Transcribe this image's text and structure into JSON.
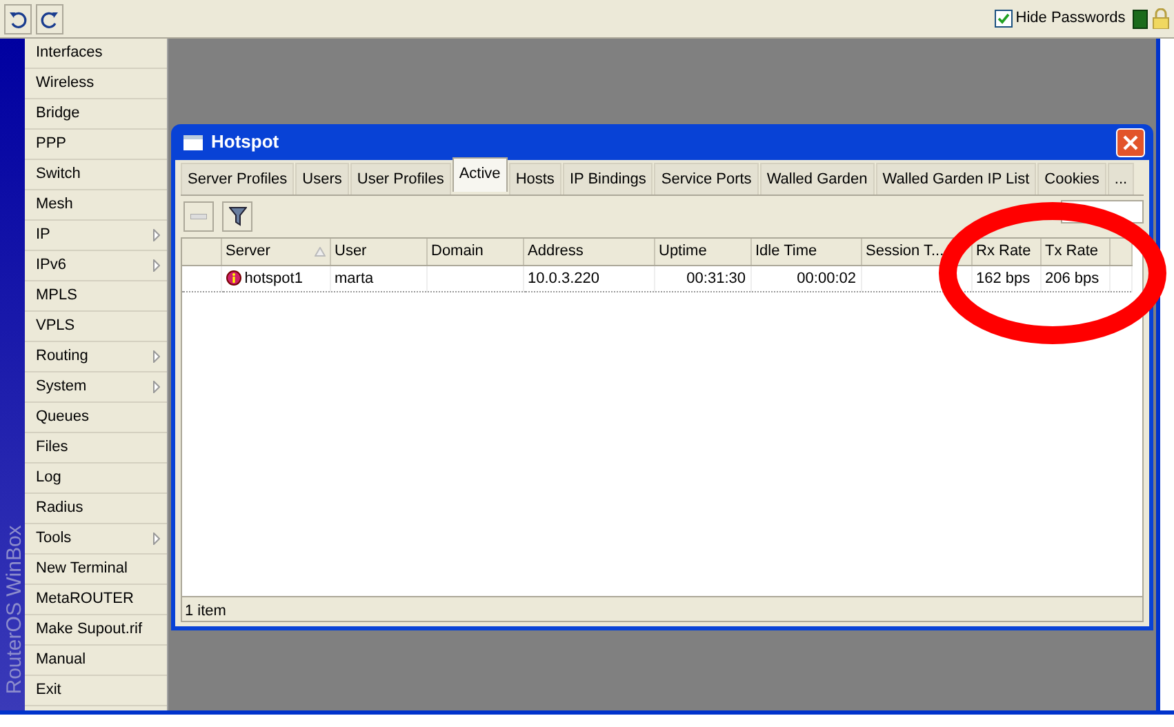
{
  "toolbar": {
    "hide_passwords": {
      "label": "Hide Passwords",
      "checked": true
    }
  },
  "sidebar": {
    "brand": "RouterOS WinBox",
    "items": [
      {
        "label": "Interfaces",
        "submenu": false
      },
      {
        "label": "Wireless",
        "submenu": false
      },
      {
        "label": "Bridge",
        "submenu": false
      },
      {
        "label": "PPP",
        "submenu": false
      },
      {
        "label": "Switch",
        "submenu": false
      },
      {
        "label": "Mesh",
        "submenu": false
      },
      {
        "label": "IP",
        "submenu": true
      },
      {
        "label": "IPv6",
        "submenu": true
      },
      {
        "label": "MPLS",
        "submenu": false
      },
      {
        "label": "VPLS",
        "submenu": false
      },
      {
        "label": "Routing",
        "submenu": true
      },
      {
        "label": "System",
        "submenu": true
      },
      {
        "label": "Queues",
        "submenu": false
      },
      {
        "label": "Files",
        "submenu": false
      },
      {
        "label": "Log",
        "submenu": false
      },
      {
        "label": "Radius",
        "submenu": false
      },
      {
        "label": "Tools",
        "submenu": true
      },
      {
        "label": "New Terminal",
        "submenu": false
      },
      {
        "label": "MetaROUTER",
        "submenu": false
      },
      {
        "label": "Make Supout.rif",
        "submenu": false
      },
      {
        "label": "Manual",
        "submenu": false
      },
      {
        "label": "Exit",
        "submenu": false
      }
    ]
  },
  "window": {
    "title": "Hotspot",
    "tabs": [
      {
        "label": "Server Profiles",
        "selected": false
      },
      {
        "label": "Users",
        "selected": false
      },
      {
        "label": "User Profiles",
        "selected": false
      },
      {
        "label": "Active",
        "selected": true
      },
      {
        "label": "Hosts",
        "selected": false
      },
      {
        "label": "IP Bindings",
        "selected": false
      },
      {
        "label": "Service Ports",
        "selected": false
      },
      {
        "label": "Walled Garden",
        "selected": false
      },
      {
        "label": "Walled Garden IP List",
        "selected": false
      },
      {
        "label": "Cookies",
        "selected": false
      },
      {
        "label": "...",
        "selected": false
      }
    ],
    "table": {
      "columns": [
        {
          "label": "Server",
          "sorted": true
        },
        {
          "label": "User",
          "sorted": false
        },
        {
          "label": "Domain",
          "sorted": false
        },
        {
          "label": "Address",
          "sorted": false
        },
        {
          "label": "Uptime",
          "sorted": false
        },
        {
          "label": "Idle Time",
          "sorted": false
        },
        {
          "label": "Session T...",
          "sorted": false
        },
        {
          "label": "Rx Rate",
          "sorted": false
        },
        {
          "label": "Tx Rate",
          "sorted": false
        }
      ],
      "rows": [
        [
          "hotspot1",
          "marta",
          "",
          "10.0.3.220",
          "00:31:30",
          "00:00:02",
          "",
          "162 bps",
          "206 bps"
        ]
      ]
    },
    "status_bar": "1 item"
  }
}
